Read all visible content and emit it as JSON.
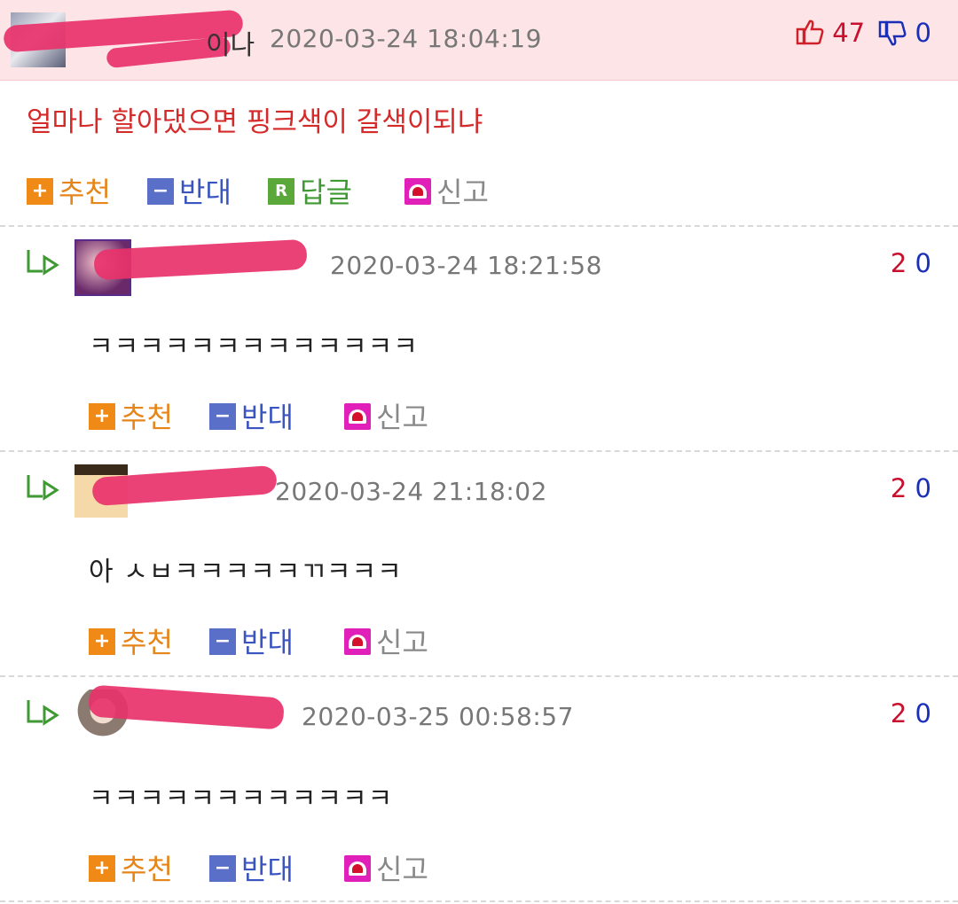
{
  "main_comment": {
    "author_suffix": "이나",
    "date": "2020-03-24 18:04:19",
    "likes": "47",
    "dislikes": "0",
    "text": "얼마나 할아댔으면 핑크색이 갈색이되냐",
    "actions": {
      "recommend": "추천",
      "oppose": "반대",
      "reply": "답글",
      "report": "신고"
    },
    "icons": [
      "thumb-up-icon",
      "thumb-down-icon",
      "plus-icon",
      "minus-icon",
      "reply-icon",
      "siren-icon"
    ]
  },
  "replies": [
    {
      "date": "2020-03-24 18:21:58",
      "likes": "2",
      "dislikes": "0",
      "text": "ㅋㅋㅋㅋㅋㅋㅋㅋㅋㅋㅋㅋㅋ",
      "actions": {
        "recommend": "추천",
        "oppose": "반대",
        "report": "신고"
      }
    },
    {
      "date": "2020-03-24 21:18:02",
      "likes": "2",
      "dislikes": "0",
      "text": "아 ㅅㅂㅋㅋㅋㅋㅋㄲㅋㅋㅋ",
      "actions": {
        "recommend": "추천",
        "oppose": "반대",
        "report": "신고"
      }
    },
    {
      "date": "2020-03-25 00:58:57",
      "likes": "2",
      "dislikes": "0",
      "text": "ㅋㅋㅋㅋㅋㅋㅋㅋㅋㅋㅋㅋ",
      "actions": {
        "recommend": "추천",
        "oppose": "반대",
        "report": "신고"
      }
    }
  ],
  "colors": {
    "header_bg": "#fde4e6",
    "main_text": "#d42a2a",
    "like": "#c8102e",
    "dislike": "#1a2fb8",
    "recommend": "#e5851a",
    "oppose": "#3a55c0",
    "reply": "#3f9a33",
    "report_badge": "#e020b8",
    "redaction": "#e8326b"
  }
}
